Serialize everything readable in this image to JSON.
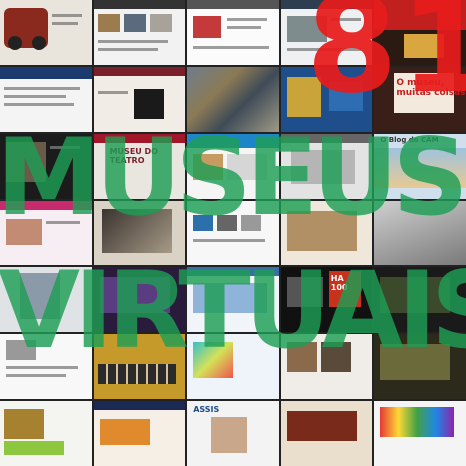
{
  "poster": {
    "number": "81",
    "line1": "MUSEUS",
    "line2": "VIRTUAIS"
  },
  "colors": {
    "number": "#e81c1c",
    "title": "#1e9e55"
  },
  "tile_texts": [
    "MUSEU DO TEATRO",
    "ASSIS",
    "HA 100",
    "O Blog do CAM",
    "O museu, muitas coisas"
  ]
}
